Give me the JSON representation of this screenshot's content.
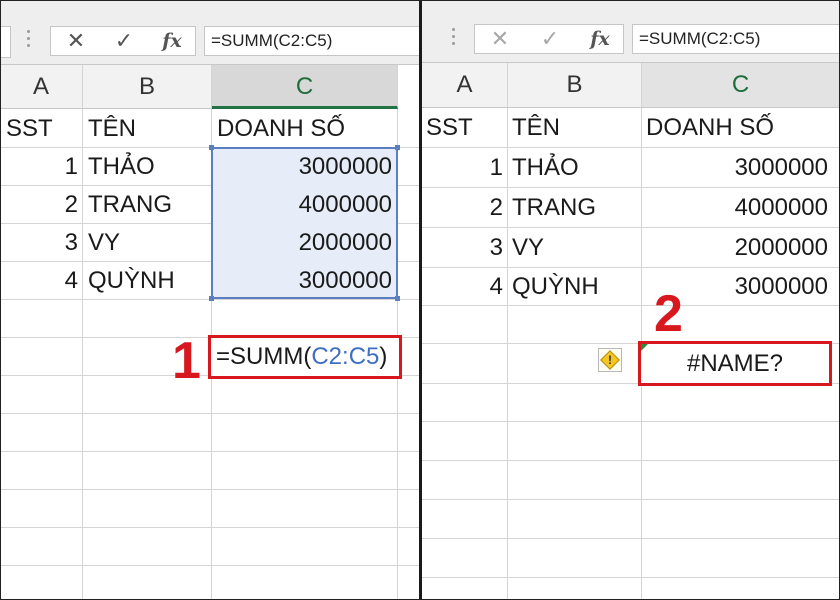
{
  "formula_bar": {
    "cancel_icon": "✕",
    "enter_icon": "✓",
    "fx_label": "fx"
  },
  "left_panel": {
    "formula_text": "=SUMM(C2:C5)",
    "col_headers": [
      "A",
      "B",
      "C"
    ],
    "headers": [
      "SST",
      "TÊN",
      "DOANH SỐ"
    ],
    "rows": [
      {
        "stt": "1",
        "name": "THẢO",
        "sales": "3000000"
      },
      {
        "stt": "2",
        "name": "TRANG",
        "sales": "4000000"
      },
      {
        "stt": "3",
        "name": "VY",
        "sales": "2000000"
      },
      {
        "stt": "4",
        "name": "QUỲNH",
        "sales": "3000000"
      }
    ],
    "edit_prefix": "=SUMM(",
    "edit_ref": "C2:C5",
    "edit_suffix": ")",
    "step_number": "1"
  },
  "right_panel": {
    "formula_text": "=SUMM(C2:C5)",
    "col_headers": [
      "A",
      "B",
      "C"
    ],
    "headers": [
      "SST",
      "TÊN",
      "DOANH SỐ"
    ],
    "rows": [
      {
        "stt": "1",
        "name": "THẢO",
        "sales": "3000000"
      },
      {
        "stt": "2",
        "name": "TRANG",
        "sales": "4000000"
      },
      {
        "stt": "3",
        "name": "VY",
        "sales": "2000000"
      },
      {
        "stt": "4",
        "name": "QUỲNH",
        "sales": "3000000"
      }
    ],
    "result_text": "#NAME?",
    "warning_icon": "!",
    "step_number": "2"
  },
  "colors": {
    "accent_green": "#217346",
    "highlight_red": "#d7191f",
    "selection_blue": "#5b7fc0",
    "ref_blue": "#3e6fc2"
  }
}
